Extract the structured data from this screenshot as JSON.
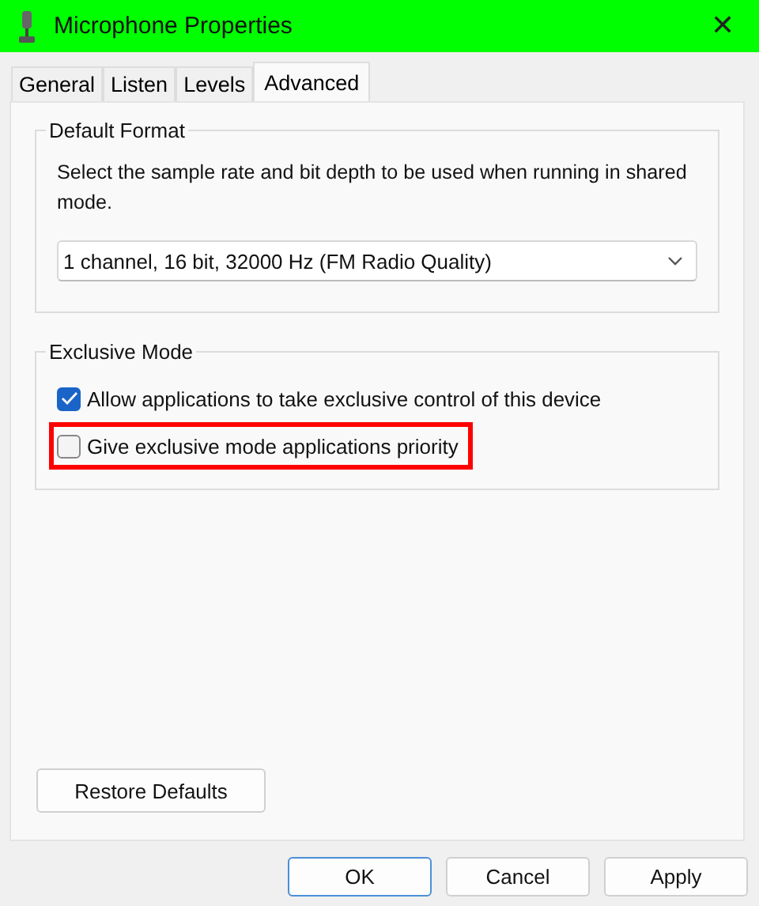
{
  "window": {
    "title": "Microphone Properties",
    "close": "✕"
  },
  "tabs": [
    {
      "label": "General",
      "selected": false
    },
    {
      "label": "Listen",
      "selected": false
    },
    {
      "label": "Levels",
      "selected": false
    },
    {
      "label": "Advanced",
      "selected": true
    }
  ],
  "default_format": {
    "title": "Default Format",
    "description": "Select the sample rate and bit depth to be used when running in shared mode.",
    "value": "1 channel, 16 bit, 32000 Hz (FM Radio Quality)"
  },
  "exclusive_mode": {
    "title": "Exclusive Mode",
    "options": [
      {
        "label": "Allow applications to take exclusive control of this device",
        "checked": true,
        "highlighted": false
      },
      {
        "label": "Give exclusive mode applications priority",
        "checked": false,
        "highlighted": true
      }
    ]
  },
  "restore_button": "Restore Defaults",
  "buttons": [
    {
      "label": "OK",
      "default": true
    },
    {
      "label": "Cancel",
      "default": false
    },
    {
      "label": "Apply",
      "default": false
    }
  ]
}
